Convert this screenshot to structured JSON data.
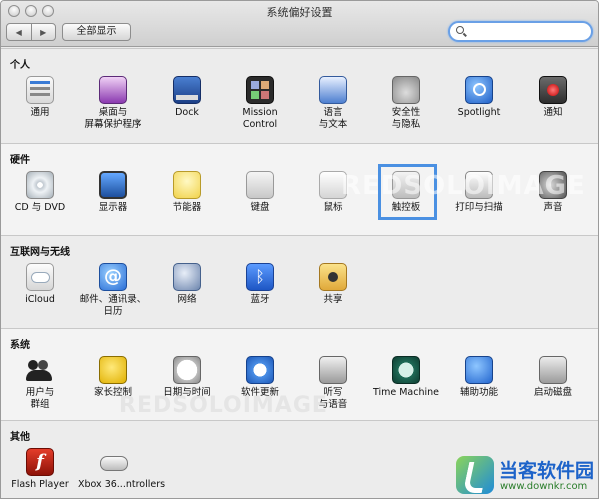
{
  "window": {
    "title": "系统偏好设置"
  },
  "toolbar": {
    "back_glyph": "◀",
    "forward_glyph": "▶",
    "show_all_label": "全部显示",
    "search_value": "",
    "search_placeholder": ""
  },
  "sections": [
    {
      "title": "个人",
      "items": [
        {
          "label": "通用",
          "icon": "general-icon"
        },
        {
          "label": "桌面与\n屏幕保护程序",
          "icon": "desktop-icon"
        },
        {
          "label": "Dock",
          "icon": "dock-icon"
        },
        {
          "label": "Mission\nControl",
          "icon": "mission-control-icon"
        },
        {
          "label": "语言\n与文本",
          "icon": "language-icon"
        },
        {
          "label": "安全性\n与隐私",
          "icon": "security-icon"
        },
        {
          "label": "Spotlight",
          "icon": "spotlight-icon"
        },
        {
          "label": "通知",
          "icon": "notifications-icon"
        }
      ]
    },
    {
      "title": "硬件",
      "items": [
        {
          "label": "CD 与 DVD",
          "icon": "cd-icon"
        },
        {
          "label": "显示器",
          "icon": "display-icon"
        },
        {
          "label": "节能器",
          "icon": "energy-saver-icon"
        },
        {
          "label": "键盘",
          "icon": "keyboard-icon"
        },
        {
          "label": "鼠标",
          "icon": "mouse-icon"
        },
        {
          "label": "触控板",
          "icon": "trackpad-icon"
        },
        {
          "label": "打印与扫描",
          "icon": "print-scan-icon"
        },
        {
          "label": "声音",
          "icon": "sound-icon"
        }
      ]
    },
    {
      "title": "互联网与无线",
      "items": [
        {
          "label": "iCloud",
          "icon": "icloud-icon"
        },
        {
          "label": "邮件、通讯录、\n日历",
          "icon": "mail-icon"
        },
        {
          "label": "网络",
          "icon": "network-icon"
        },
        {
          "label": "蓝牙",
          "icon": "bluetooth-icon"
        },
        {
          "label": "共享",
          "icon": "sharing-icon"
        }
      ]
    },
    {
      "title": "系统",
      "items": [
        {
          "label": "用户与\n群组",
          "icon": "users-icon"
        },
        {
          "label": "家长控制",
          "icon": "parental-controls-icon"
        },
        {
          "label": "日期与时间",
          "icon": "date-time-icon"
        },
        {
          "label": "软件更新",
          "icon": "software-update-icon"
        },
        {
          "label": "听写\n与语音",
          "icon": "dictation-icon"
        },
        {
          "label": "Time Machine",
          "icon": "time-machine-icon"
        },
        {
          "label": "辅助功能",
          "icon": "accessibility-icon"
        },
        {
          "label": "启动磁盘",
          "icon": "startup-disk-icon"
        }
      ]
    },
    {
      "title": "其他",
      "items": [
        {
          "label": "Flash Player",
          "icon": "flash-player-icon"
        },
        {
          "label": "Xbox 36...ntrollers",
          "icon": "xbox-controller-icon"
        }
      ]
    }
  ],
  "icon_glyphs": {
    "mail": "@",
    "bluetooth": "ᛒ",
    "flash": "f"
  },
  "watermark": "REDSOLOIMAGE",
  "brand": {
    "name": "当客软件园",
    "url": "www.downkr.com"
  },
  "colors": {
    "highlight": "#4a90e2",
    "brand_blue": "#1d63c9"
  }
}
